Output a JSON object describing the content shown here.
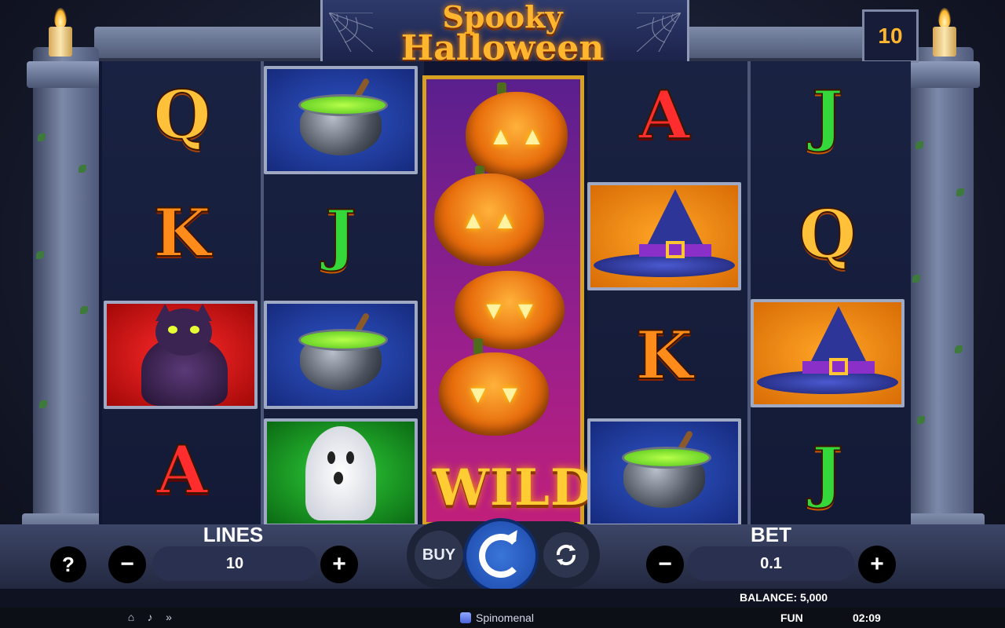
{
  "game": {
    "title_line1": "Spooky",
    "title_line2": "Halloween",
    "lines_badge": "10",
    "wild_label": "WILD"
  },
  "reels": [
    [
      "Q",
      "K",
      "cat",
      "A"
    ],
    [
      "cauldron",
      "J",
      "cauldron",
      "ghost"
    ],
    [
      "wild"
    ],
    [
      "A",
      "witch-hat",
      "K",
      "cauldron"
    ],
    [
      "J",
      "Q",
      "witch-hat",
      "J"
    ]
  ],
  "controls": {
    "help_label": "?",
    "lines_label": "LINES",
    "lines_value": "10",
    "minus_label": "−",
    "plus_label": "+",
    "buy_label": "BUY",
    "bet_label": "BET",
    "bet_value": "0.1"
  },
  "status": {
    "balance": "BALANCE: 5,000",
    "mode": "FUN",
    "time": "02:09",
    "brand": "Spinomenal"
  },
  "icons": [
    "home-icon",
    "sound-icon",
    "turbo-icon",
    "autoplay-icon",
    "spin-icon"
  ],
  "colors": {
    "accent": "#ffb62e",
    "spin_button": "#2b5fc4",
    "wild_frame": "#d7a224"
  }
}
